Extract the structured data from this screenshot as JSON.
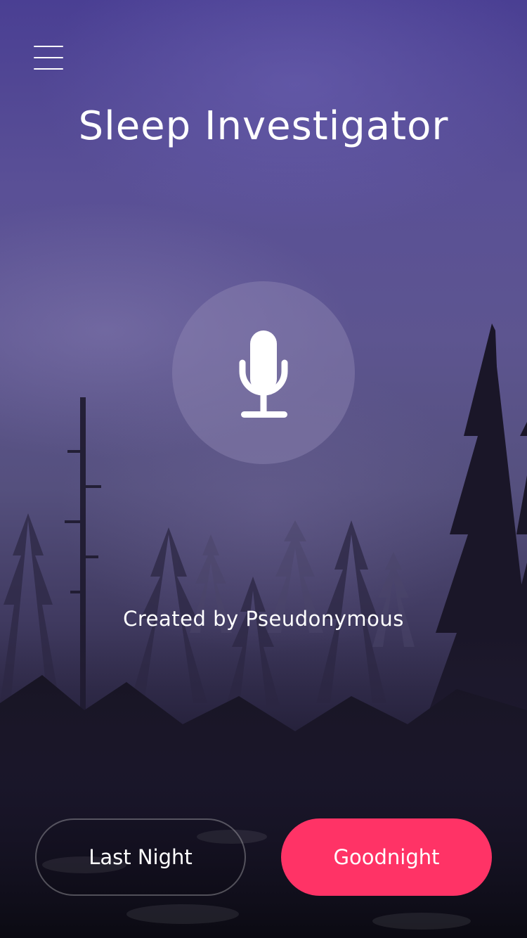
{
  "app": {
    "title": "Sleep Investigator",
    "credit": "Created by Pseudonymous"
  },
  "header": {
    "menu_icon": "hamburger-menu-icon"
  },
  "record": {
    "icon": "microphone-icon"
  },
  "actions": {
    "last_night_label": "Last Night",
    "goodnight_label": "Goodnight"
  },
  "colors": {
    "accent": "#ff3366",
    "background_top": "#4a3f93",
    "background_bottom": "#0d0b15"
  }
}
